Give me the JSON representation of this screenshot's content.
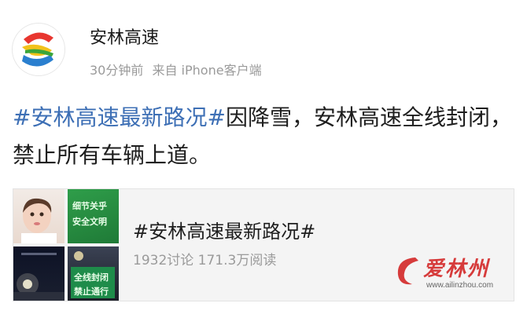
{
  "post": {
    "username": "安林高速",
    "time": "30分钟前",
    "source": "来自 iPhone客户端",
    "hashtag": "#安林高速最新路况#",
    "text": "因降雪，安林高速全线封闭，禁止所有车辆上道。"
  },
  "topic_card": {
    "title": "#安林高速最新路况#",
    "discussions": "1932讨论",
    "reads": "171.3万阅读",
    "thumb_sign_1": "细节关乎",
    "thumb_sign_2": "安全文明",
    "thumb_sign_3": "全线封闭",
    "thumb_sign_4": "禁止通行"
  },
  "watermark": {
    "logo_text": "爱林州",
    "url": "www.ailinzhou.com"
  },
  "colors": {
    "hashtag": "#3d6fb5",
    "meta_gray": "#9a9a9a",
    "logo_red": "#e8362f",
    "logo_green": "#3aa53a",
    "logo_blue": "#2a7fcf",
    "logo_yellow": "#f2c21b"
  }
}
